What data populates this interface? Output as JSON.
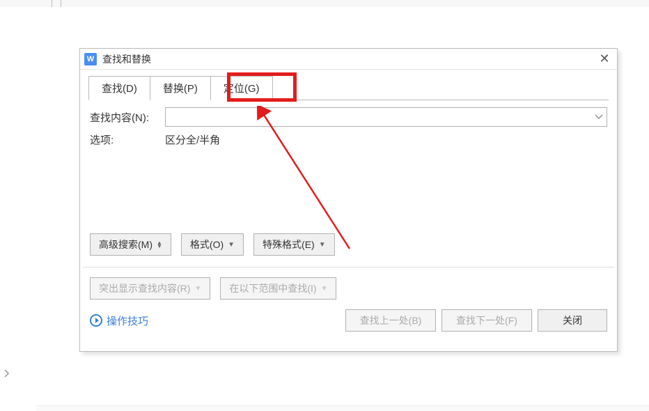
{
  "dialog": {
    "title": "查找和替换",
    "tabs": {
      "find": "查找(D)",
      "replace": "替换(P)",
      "goto": "定位(G)"
    },
    "form": {
      "find_label": "查找内容(N):",
      "find_value": "",
      "options_label": "选项:",
      "options_value": "区分全/半角"
    },
    "buttons": {
      "advanced": "高级搜索(M)",
      "format": "格式(O)",
      "special": "特殊格式(E)",
      "highlight": "突出显示查找内容(R)",
      "search_in": "在以下范围中查找(I)"
    },
    "footer": {
      "help": "操作技巧",
      "find_prev": "查找上一处(B)",
      "find_next": "查找下一处(F)",
      "close": "关闭"
    }
  },
  "annotation": {
    "highlight_color": "#e21c1c"
  }
}
